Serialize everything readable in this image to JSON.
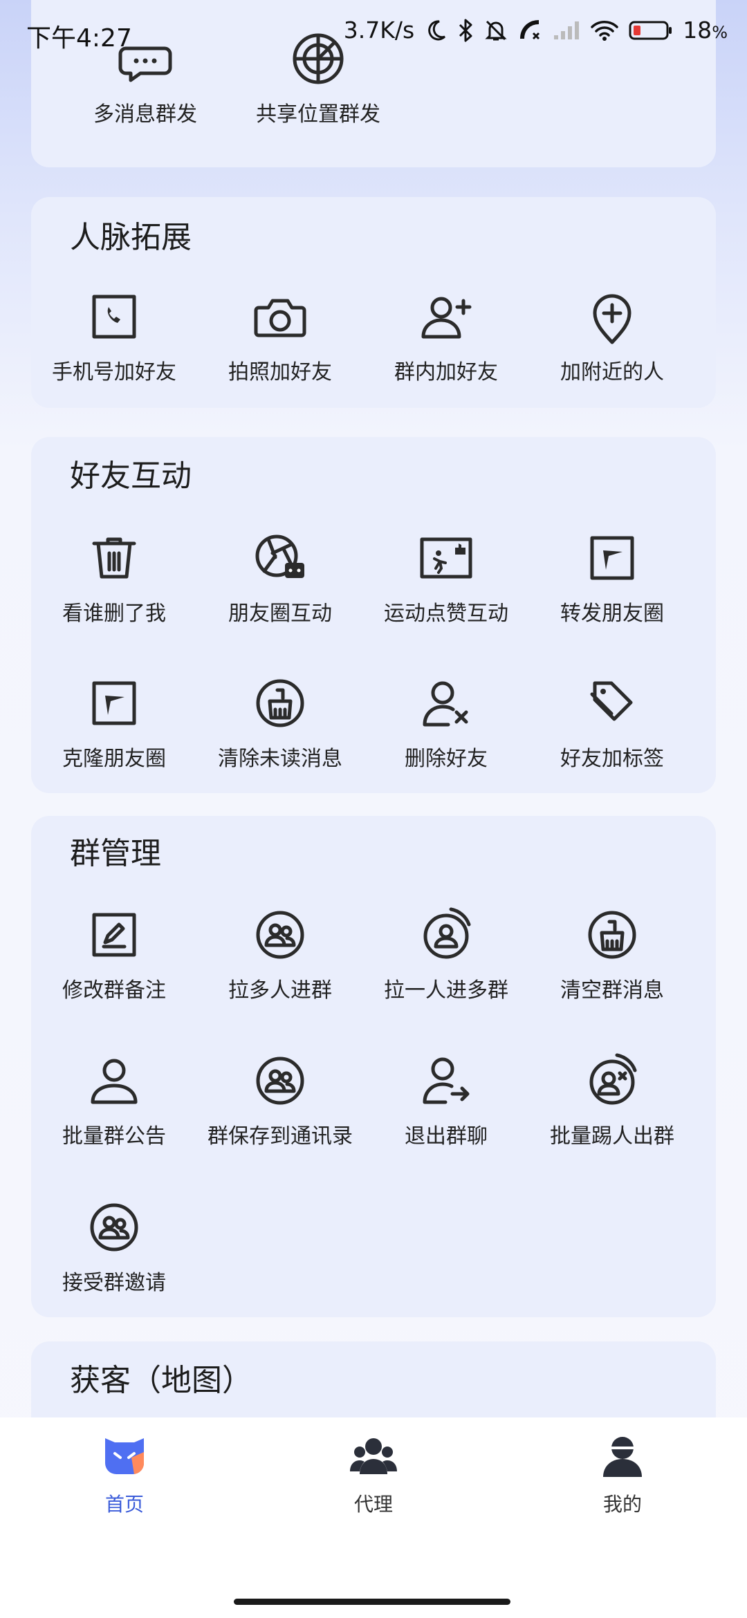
{
  "status_bar": {
    "time": "下午4:27",
    "speed": "3.7K/s",
    "battery": "18"
  },
  "top_card": {
    "items": [
      {
        "label": "多消息群发",
        "icon": "chat-bubble-icon"
      },
      {
        "label": "共享位置群发",
        "icon": "radar-icon"
      }
    ]
  },
  "network": {
    "title": "人脉拓展",
    "items": [
      {
        "label": "手机号加好友",
        "icon": "phone-icon"
      },
      {
        "label": "拍照加好友",
        "icon": "camera-icon"
      },
      {
        "label": "群内加好友",
        "icon": "add-user-icon"
      },
      {
        "label": "加附近的人",
        "icon": "location-plus-icon"
      }
    ]
  },
  "friends": {
    "title": "好友互动",
    "items": [
      {
        "label": "看谁删了我",
        "icon": "trash-icon"
      },
      {
        "label": "朋友圈互动",
        "icon": "moments-chat-icon"
      },
      {
        "label": "运动点赞互动",
        "icon": "sport-like-icon"
      },
      {
        "label": "转发朋友圈",
        "icon": "forward-icon"
      },
      {
        "label": "克隆朋友圈",
        "icon": "clone-icon"
      },
      {
        "label": "清除未读消息",
        "icon": "broom-icon"
      },
      {
        "label": "删除好友",
        "icon": "remove-user-icon"
      },
      {
        "label": "好友加标签",
        "icon": "tag-icon"
      }
    ]
  },
  "groups": {
    "title": "群管理",
    "items": [
      {
        "label": "修改群备注",
        "icon": "edit-icon"
      },
      {
        "label": "拉多人进群",
        "icon": "group-icon"
      },
      {
        "label": "拉一人进多群",
        "icon": "user-circle-icon"
      },
      {
        "label": "清空群消息",
        "icon": "broom-icon"
      },
      {
        "label": "批量群公告",
        "icon": "user-icon"
      },
      {
        "label": "群保存到通讯录",
        "icon": "group-save-icon"
      },
      {
        "label": "退出群聊",
        "icon": "exit-user-icon"
      },
      {
        "label": "批量踢人出群",
        "icon": "kick-user-icon"
      },
      {
        "label": "接受群邀请",
        "icon": "group-accept-icon"
      }
    ]
  },
  "map_card": {
    "title": "获客（地图）"
  },
  "tabs": [
    {
      "label": "首页",
      "icon": "home-logo-icon",
      "active": true
    },
    {
      "label": "代理",
      "icon": "agents-icon",
      "active": false
    },
    {
      "label": "我的",
      "icon": "profile-icon",
      "active": false
    }
  ]
}
